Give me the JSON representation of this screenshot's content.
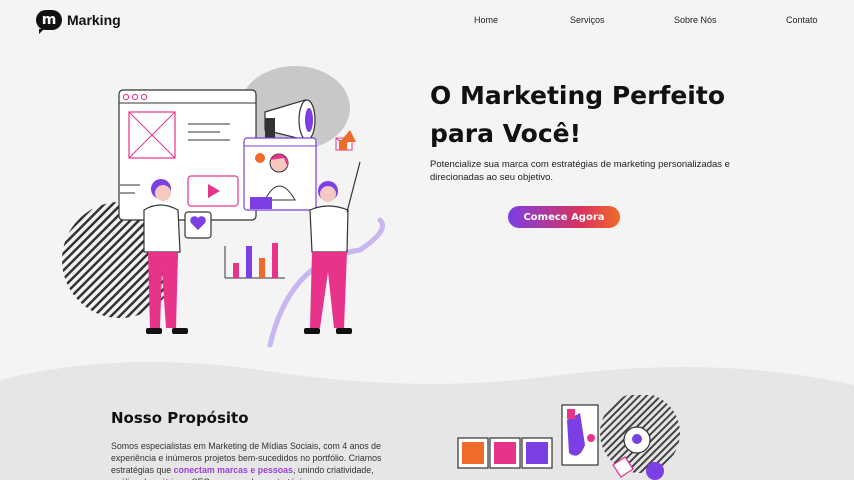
{
  "brand": {
    "logo_letter": "m",
    "name": "Marking"
  },
  "nav": {
    "items": [
      "Home",
      "Serviços",
      "Sobre Nós",
      "Contato"
    ]
  },
  "hero": {
    "title_line1": "O Marketing Perfeito",
    "title_line2": "para Você!",
    "subtitle": "Potencialize sua marca com estratégias de marketing personalizadas e direcionadas ao seu objetivo.",
    "cta_label": "Comece Agora"
  },
  "purpose": {
    "title": "Nosso Propósito",
    "body_part1": "Somos especialistas em Marketing de Mídias Sociais, com 4 anos de experiência e inúmeros projetos bem-sucedidos no portfólio. Criamos estratégias que ",
    "body_highlight": "conectam marcas e pessoas",
    "body_part2": ", unindo criatividade, análise de métricas, SEO e campanhas estratégicas para gerar..."
  },
  "colors": {
    "accent_purple": "#7b3fe4",
    "accent_pink": "#e8338a",
    "accent_orange": "#f06a2a",
    "background": "#f4f4f4"
  }
}
